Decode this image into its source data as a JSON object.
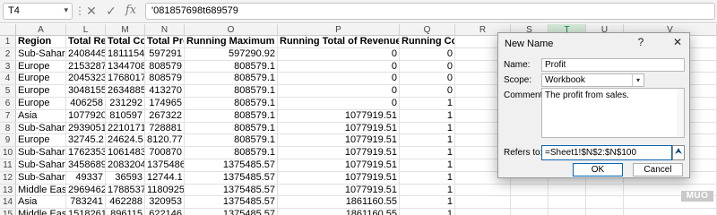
{
  "formula_bar": {
    "name_box": "T4",
    "cancel_icon": "✕",
    "enter_icon": "✓",
    "fx_label": "fx",
    "formula": "'081857698t689579"
  },
  "columns": [
    "A",
    "L",
    "M",
    "N",
    "O",
    "P",
    "Q",
    "R",
    "S",
    "T",
    "U",
    "V"
  ],
  "selected_column": "T",
  "rows": [
    {
      "n": "1",
      "header": true,
      "cells": [
        "Region",
        "Total Reve",
        "Total Cost",
        "Total Profi",
        "Running Maximum Profit",
        "Running Total of Revenue in Asia",
        "Running Count of Cereal C"
      ]
    },
    {
      "n": "2",
      "cells": [
        "Sub-Saharan",
        "2408445",
        "1811154",
        "597291",
        "597290.92",
        "0",
        "0"
      ]
    },
    {
      "n": "3",
      "cells": [
        "Europe",
        "2153287",
        "1344708",
        "808579",
        "808579.1",
        "0",
        "0"
      ]
    },
    {
      "n": "4",
      "cells": [
        "Europe",
        "2045323",
        "1768017",
        "808579",
        "808579.1",
        "0",
        "0"
      ]
    },
    {
      "n": "5",
      "cells": [
        "Europe",
        "3048155",
        "2634885",
        "413270",
        "808579.1",
        "0",
        "0"
      ]
    },
    {
      "n": "6",
      "cells": [
        "Europe",
        "406258",
        "231292",
        "174965",
        "808579.1",
        "0",
        "1"
      ]
    },
    {
      "n": "7",
      "cells": [
        "Asia",
        "1077920",
        "810597",
        "267322",
        "808579.1",
        "1077919.51",
        "1"
      ]
    },
    {
      "n": "8",
      "cells": [
        "Sub-Saharan",
        "2939051",
        "2210171",
        "728881",
        "808579.1",
        "1077919.51",
        "1"
      ]
    },
    {
      "n": "9",
      "cells": [
        "Europe",
        "32745.2",
        "24624.5",
        "8120.77",
        "808579.1",
        "1077919.51",
        "1"
      ]
    },
    {
      "n": "10",
      "cells": [
        "Sub-Saharan",
        "1762353",
        "1061483",
        "700870",
        "808579.1",
        "1077919.51",
        "1"
      ]
    },
    {
      "n": "11",
      "cells": [
        "Sub-Saharan",
        "3458689",
        "2083204",
        "1375486",
        "1375485.57",
        "1077919.51",
        "1"
      ]
    },
    {
      "n": "12",
      "cells": [
        "Sub-Saharan",
        "49337",
        "36593",
        "12744.1",
        "1375485.57",
        "1077919.51",
        "1"
      ]
    },
    {
      "n": "13",
      "cells": [
        "Middle East a",
        "2969462",
        "1788537",
        "1180925",
        "1375485.57",
        "1077919.51",
        "1"
      ]
    },
    {
      "n": "14",
      "cells": [
        "Asia",
        "783241",
        "462288",
        "320953",
        "1375485.57",
        "1861160.55",
        "1"
      ]
    },
    {
      "n": "15",
      "cells": [
        "Middle East a",
        "1518261",
        "896115",
        "622146",
        "1375485.57",
        "1861160.55",
        "1"
      ]
    }
  ],
  "dialog": {
    "title": "New Name",
    "help_icon": "?",
    "close_icon": "✕",
    "name_label": "Name:",
    "name_value": "Profit",
    "scope_label": "Scope:",
    "scope_value": "Workbook",
    "comment_label": "Comment:",
    "comment_value": "The profit from sales.",
    "refers_label": "Refers to:",
    "refers_value": "=Sheet1!$N$2:$N$100",
    "ok_label": "OK",
    "cancel_label": "Cancel"
  },
  "watermark": "MUO",
  "colors": {
    "accent": "#107c41",
    "focus": "#0067c0"
  }
}
